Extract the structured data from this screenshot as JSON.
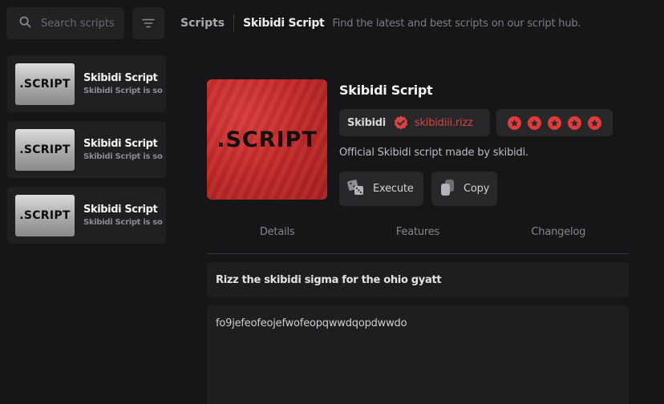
{
  "search": {
    "placeholder": "Search scripts",
    "icon": "search-icon"
  },
  "filter": {
    "icon": "filter-icon"
  },
  "breadcrumb": {
    "root": "Scripts",
    "current": "Skibidi Script",
    "description": "Find the latest and best scripts on our script hub."
  },
  "sidebar": {
    "items": [
      {
        "thumb_label": ".SCRIPT",
        "title": "Skibidi Script",
        "subtitle": "Skibidi Script is so"
      },
      {
        "thumb_label": ".SCRIPT",
        "title": "Skibidi Script",
        "subtitle": "Skibidi Script is so"
      },
      {
        "thumb_label": ".SCRIPT",
        "title": "Skibidi Script",
        "subtitle": "Skibidi Script is so"
      }
    ]
  },
  "script": {
    "thumb_label": ".SCRIPT",
    "title": "Skibidi Script",
    "author": "Skibidi",
    "handle": "skibidiii.rizz",
    "rating": 5,
    "rating_max": 5,
    "description": "Official Skibidi script made by skibidi.",
    "execute_label": "Execute",
    "copy_label": "Copy"
  },
  "tabs": [
    {
      "label": "Details"
    },
    {
      "label": "Features"
    },
    {
      "label": "Changelog"
    }
  ],
  "details": {
    "summary": "Rizz the skibidi sigma for the ohio gyatt",
    "code": "fo9jefeofeojefwofeopqwwdqopdwwdo"
  },
  "colors": {
    "background": "#161618",
    "panel": "#28282b",
    "accent": "#e03a3a"
  }
}
